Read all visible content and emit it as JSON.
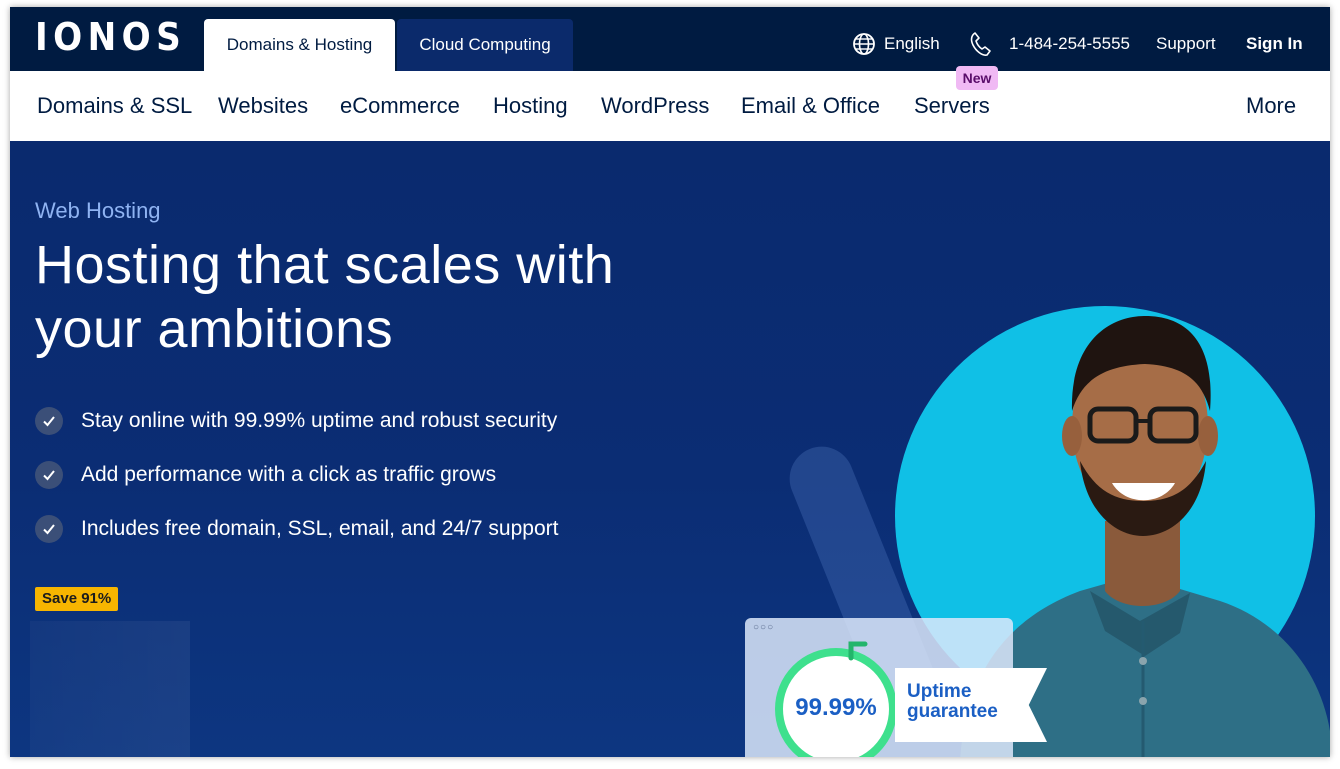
{
  "brand": {
    "logo": "IONOS"
  },
  "top_tabs": [
    {
      "label": "Domains & Hosting"
    },
    {
      "label": "Cloud Computing"
    }
  ],
  "utility": {
    "language": "English",
    "phone": "1-484-254-5555",
    "support": "Support",
    "sign_in": "Sign In"
  },
  "nav": {
    "items": [
      {
        "label": "Domains & SSL"
      },
      {
        "label": "Websites"
      },
      {
        "label": "eCommerce"
      },
      {
        "label": "Hosting"
      },
      {
        "label": "WordPress"
      },
      {
        "label": "Email & Office"
      },
      {
        "label": "Servers"
      }
    ],
    "new_badge": "New",
    "more": "More"
  },
  "hero": {
    "eyebrow": "Web Hosting",
    "title_line1": "Hosting that scales with",
    "title_line2": "your ambitions",
    "features": [
      "Stay online with 99.99% uptime and robust security",
      "Add performance with a click as traffic grows",
      "Includes free domain, SSL, email, and 24/7 support"
    ],
    "save_badge": "Save 91%",
    "uptime_value": "99.99%",
    "uptime_label_line1": "Uptime",
    "uptime_label_line2": "guarantee"
  },
  "colors": {
    "topbar": "#001b41",
    "hero": "#0b2a6b",
    "accent_cyan": "#10c0e6",
    "ring_green": "#3ee08d",
    "badge_yellow": "#f7b500",
    "new_badge": "#f0b9f4"
  },
  "icons": [
    "globe-icon",
    "phone-icon",
    "check-icon"
  ]
}
